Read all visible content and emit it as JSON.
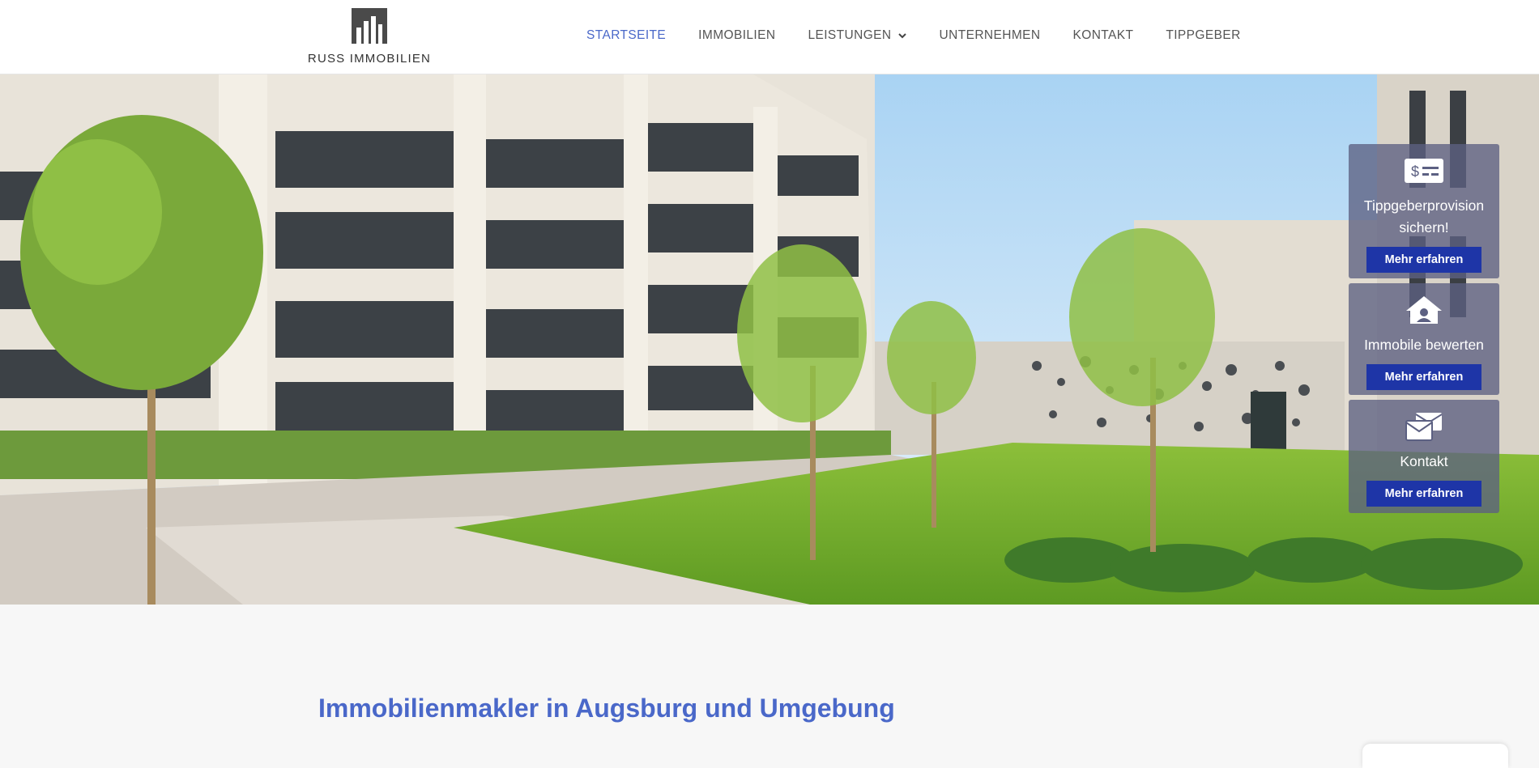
{
  "brand": {
    "name": "RUSS IMMOBILIEN",
    "logo_icon": "building-bars-logo"
  },
  "nav": {
    "items": [
      {
        "label": "STARTSEITE",
        "active": true
      },
      {
        "label": "IMMOBILIEN",
        "active": false
      },
      {
        "label": "LEISTUNGEN",
        "active": false,
        "has_dropdown": true
      },
      {
        "label": "UNTERNEHMEN",
        "active": false
      },
      {
        "label": "KONTAKT",
        "active": false
      },
      {
        "label": "TIPPGEBER",
        "active": false
      }
    ]
  },
  "hero": {
    "image": "apartment-building-courtyard-photo"
  },
  "cards": [
    {
      "icon": "money-check-dollar-icon",
      "title": "Tippgeberprovision sichern!",
      "button": "Mehr erfahren"
    },
    {
      "icon": "house-user-icon",
      "title": "Immobile bewerten",
      "button": "Mehr erfahren"
    },
    {
      "icon": "envelopes-icon",
      "title": "Kontakt",
      "button": "Mehr erfahren"
    }
  ],
  "content": {
    "headline": "Immobilienmakler in Augsburg und Umgebung"
  },
  "colors": {
    "accent": "#4a68c9",
    "button": "#1e35a7",
    "card_bg": "#5c6082"
  }
}
